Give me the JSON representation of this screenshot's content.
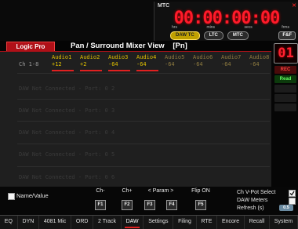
{
  "mtc": {
    "label": "MTC",
    "corner": "✕",
    "timecode": "00:00:00:00",
    "units": [
      "hrs",
      "mins",
      "secs",
      "frms"
    ],
    "buttons": [
      {
        "label": "DAW TC",
        "active": true
      },
      {
        "label": "LTC",
        "active": false
      },
      {
        "label": "MTC",
        "active": false
      }
    ],
    "ff_label": "F&F"
  },
  "header": {
    "tab_label": "Logic Pro",
    "title": "Pan / Surround Mixer View",
    "mode": "[Pn]"
  },
  "main": {
    "channel_range": "Ch 1-8",
    "tracks": [
      {
        "name": "Audio1",
        "value": "+12",
        "active": true
      },
      {
        "name": "Audio2",
        "value": "+2",
        "active": true
      },
      {
        "name": "Audio3",
        "value": "-64",
        "active": true
      },
      {
        "name": "Audio4",
        "value": "-64",
        "active": true
      },
      {
        "name": "Audio5",
        "value": "-64",
        "active": false
      },
      {
        "name": "Audio6",
        "value": "-64",
        "active": false
      },
      {
        "name": "Audio7",
        "value": "-64",
        "active": false
      },
      {
        "name": "Audio8",
        "value": "-64",
        "active": false
      }
    ],
    "port_rows": [
      "DAW Not Connected - Port: 0 2",
      "DAW Not Connected - Port: 0 3",
      "DAW Not Connected - Port: 0 4",
      "DAW Not Connected - Port: 0 5",
      "DAW Not Connected - Port: 0 6"
    ]
  },
  "right": {
    "layer_number": "01",
    "rec_label": "REC",
    "read_label": "Read"
  },
  "controls": {
    "name_value_label": "Name/Value",
    "function_keys": [
      {
        "label": "Ch-",
        "key": "F1"
      },
      {
        "label": "Ch+",
        "key": "F2"
      },
      {
        "label": "< Param >",
        "key": "F3"
      },
      {
        "label": "",
        "key": "F4"
      },
      {
        "label": "Flip ON",
        "key": "F5"
      }
    ],
    "ch_vpot_select_label": "Ch V-Pot Select",
    "daw_meters_label": "DAW Meters",
    "refresh_label": "Refresh (s)",
    "refresh_value": "0.5"
  },
  "nav": {
    "items": [
      "EQ",
      "DYN",
      "4081 Mic",
      "ORD",
      "2 Track",
      "DAW",
      "Settings",
      "Filing",
      "RTE",
      "Encore",
      "Recall",
      "System"
    ],
    "active": "DAW"
  },
  "colors": {
    "accent_red": "#e02020",
    "track_yellow": "#e0c000",
    "timecode_red": "#ff1a2a"
  }
}
